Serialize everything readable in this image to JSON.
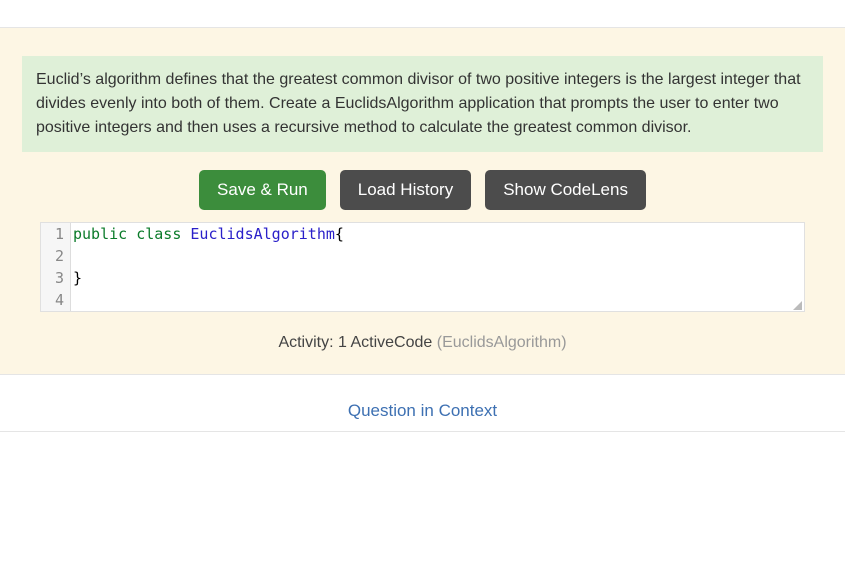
{
  "description": "Euclid’s algorithm defines that the greatest common divisor of two positive integers is the largest integer that divides evenly into both of them. Create a EuclidsAlgorithm application that prompts the user to enter two positive integers and then uses a recursive method to calculate the greatest common divisor.",
  "buttons": {
    "save_run": "Save & Run",
    "load_history": "Load History",
    "codelens": "Show CodeLens"
  },
  "code": {
    "line1": {
      "kw_public": "public",
      "kw_class": "class",
      "ident": "EuclidsAlgorithm",
      "tail": "{"
    },
    "line2": "",
    "line3": "}",
    "line4": ""
  },
  "activity": {
    "prefix": "Activity: 1 ActiveCode ",
    "faded": "(EuclidsAlgorithm)"
  },
  "context_link": "Question in Context"
}
